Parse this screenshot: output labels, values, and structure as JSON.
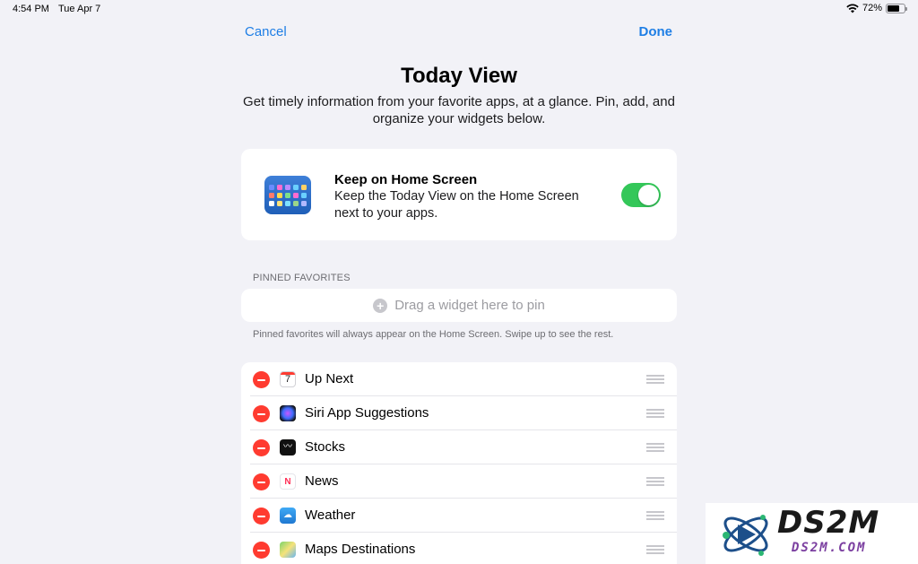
{
  "status_bar": {
    "time": "4:54 PM",
    "date": "Tue Apr 7",
    "battery_percent": "72%",
    "battery_level": 0.72,
    "wifi_icon": "wifi-icon"
  },
  "nav": {
    "cancel_label": "Cancel",
    "done_label": "Done"
  },
  "header": {
    "title": "Today View",
    "subtitle": "Get timely information from your favorite apps, at a glance. Pin, add, and organize your widgets below."
  },
  "home_screen": {
    "title": "Keep on Home Screen",
    "description": "Keep the Today View on the Home Screen next to your apps.",
    "toggle_on": true,
    "accent_color": "#34c759"
  },
  "pinned": {
    "section_header": "PINNED FAVORITES",
    "drop_zone_label": "Drag a widget here to pin",
    "footer_note": "Pinned favorites will always appear on the Home Screen. Swipe up to see the rest."
  },
  "widgets": [
    {
      "label": "Up Next",
      "icon": "calendar-icon",
      "icon_text": "7"
    },
    {
      "label": "Siri App Suggestions",
      "icon": "siri-icon",
      "icon_text": ""
    },
    {
      "label": "Stocks",
      "icon": "stocks-icon",
      "icon_text": "〰"
    },
    {
      "label": "News",
      "icon": "news-icon",
      "icon_text": "N"
    },
    {
      "label": "Weather",
      "icon": "weather-icon",
      "icon_text": "☁"
    },
    {
      "label": "Maps Destinations",
      "icon": "maps-icon",
      "icon_text": ""
    }
  ],
  "watermark": {
    "brand": "DS2M",
    "url": "DS2M.COM"
  },
  "colors": {
    "background": "#f2f2f7",
    "link_blue": "#1e7ee5",
    "remove_red": "#ff3b30"
  }
}
